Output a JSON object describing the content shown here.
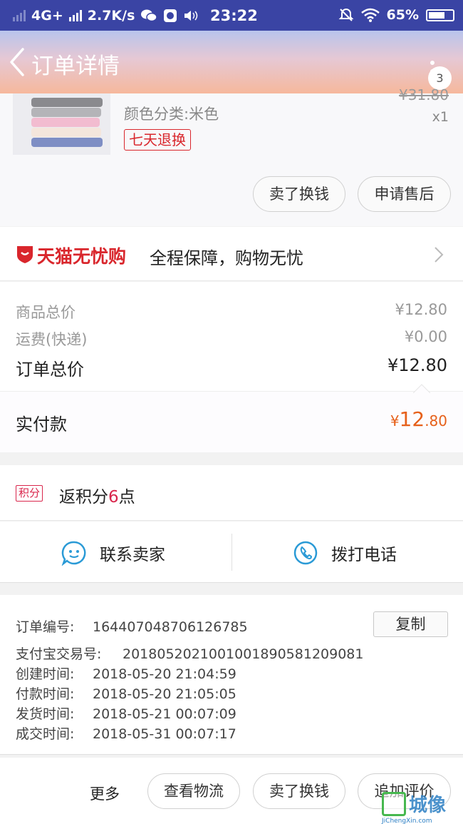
{
  "status_bar": {
    "network": "4G+",
    "speed": "2.7K/s",
    "time": "23:22",
    "battery": "65%"
  },
  "header": {
    "title": "订单详情",
    "badge_count": "3"
  },
  "product": {
    "variant": "颜色分类:米色",
    "tag": "七天退换",
    "original_price": "¥31.80",
    "quantity": "x1",
    "buttons": [
      "卖了换钱",
      "申请售后"
    ]
  },
  "guarantee": {
    "brand": "天猫无忧购",
    "text": "全程保障，购物无忧"
  },
  "totals": {
    "goods_label": "商品总价",
    "goods_value": "¥12.80",
    "shipping_label": "运费(快递)",
    "shipping_value": "¥0.00",
    "order_label": "订单总价",
    "order_value": "¥12.80"
  },
  "paid": {
    "label": "实付款",
    "currency": "¥",
    "integer": "12",
    "decimal": ".80"
  },
  "points": {
    "tag": "积分",
    "prefix": "返积分",
    "number": "6",
    "suffix": "点"
  },
  "contact": {
    "seller": "联系卖家",
    "call": "拨打电话"
  },
  "order_info": {
    "order_no_label": "订单编号:",
    "order_no": "1644070487061267​85",
    "copy_label": "复制",
    "alipay_label": "支付宝交易号:",
    "alipay_no": "2018052021001001890581209081",
    "created_label": "创建时间:",
    "created": "2018-05-20 21:04:59",
    "paid_label": "付款时间:",
    "paid": "2018-05-20 21:05:05",
    "shipped_label": "发货时间:",
    "shipped": "2018-05-21 00:07:09",
    "completed_label": "成交时间:",
    "completed": "2018-05-31 00:07:17"
  },
  "bottom": {
    "more": "更多",
    "logistics": "查看物流",
    "sell": "卖了换钱",
    "review": "追加评价"
  },
  "watermark": {
    "text": "城像",
    "url": "JiChengXin.com"
  },
  "colors": {
    "accent_red": "#d9262c",
    "price_orange": "#e6601a",
    "icon_blue": "#2a9ad6",
    "status_bar": "#3a44a4"
  }
}
